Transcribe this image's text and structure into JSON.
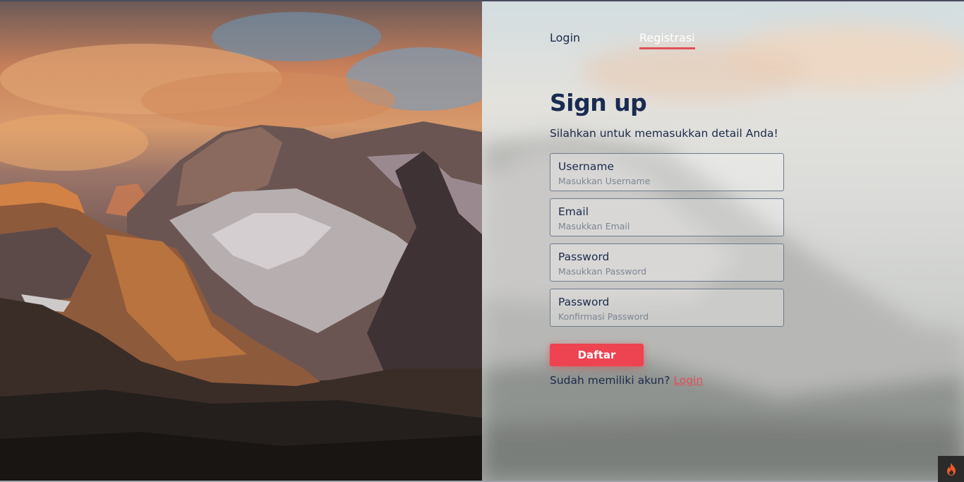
{
  "tabs": {
    "login": "Login",
    "register": "Registrasi"
  },
  "form": {
    "title": "Sign up",
    "subtitle": "Silahkan untuk memasukkan detail Anda!",
    "fields": [
      {
        "label": "Username",
        "placeholder": "Masukkan Username"
      },
      {
        "label": "Email",
        "placeholder": "Masukkan Email"
      },
      {
        "label": "Password",
        "placeholder": "Masukkan Password"
      },
      {
        "label": "Password",
        "placeholder": "Konfirmasi Password"
      }
    ],
    "submit_label": "Daftar",
    "footer_text": "Sudah memiliki akun?",
    "footer_link": "Login"
  },
  "colors": {
    "accent": "#ee4350",
    "text": "#1c2a4a",
    "title": "#1a2b52"
  },
  "icons": {
    "corner": "flame-icon"
  }
}
